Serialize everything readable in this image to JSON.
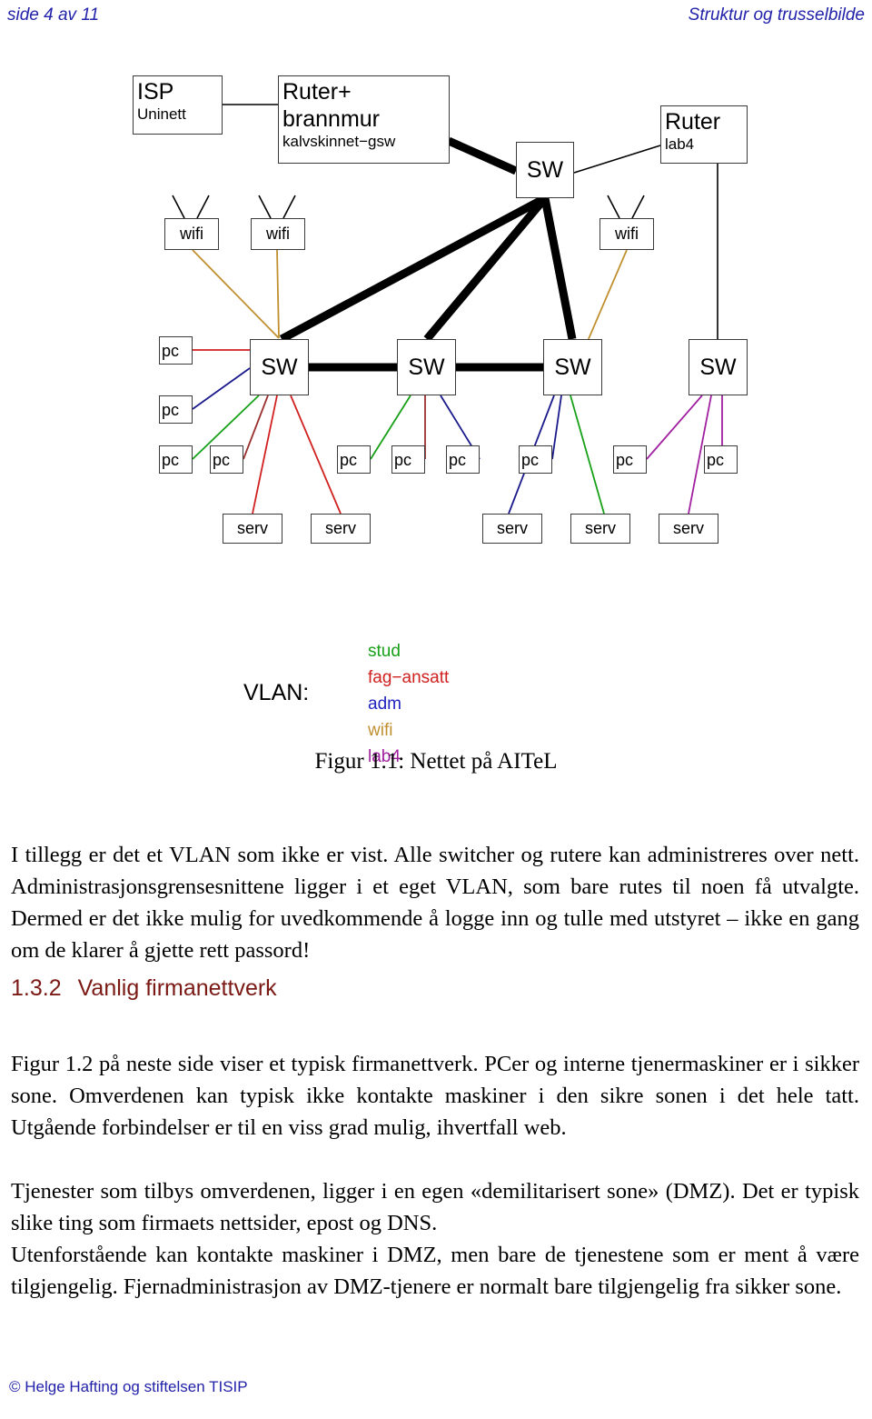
{
  "header": {
    "left": "side 4 av 11",
    "right": "Struktur og trusselbilde"
  },
  "figure": {
    "caption": "Figur 1.1: Nettet på AITeL",
    "nodes": {
      "isp": {
        "title": "ISP",
        "sub": "Uninett"
      },
      "firewall": {
        "title": "Ruter+",
        "title2": "brannmur",
        "sub": "kalvskinnet−gsw"
      },
      "core_sw": {
        "label": "SW"
      },
      "router_lab4": {
        "title": "Ruter",
        "sub": "lab4"
      },
      "wifi": [
        {
          "label": "wifi"
        },
        {
          "label": "wifi"
        },
        {
          "label": "wifi"
        }
      ],
      "switches": [
        {
          "label": "SW"
        },
        {
          "label": "SW"
        },
        {
          "label": "SW"
        },
        {
          "label": "SW"
        }
      ],
      "pcs_left_stack": [
        {
          "label": "pc"
        },
        {
          "label": "pc"
        }
      ],
      "pcs_row": [
        {
          "label": "pc"
        },
        {
          "label": "pc"
        },
        {
          "label": "pc"
        },
        {
          "label": "pc"
        },
        {
          "label": "pc"
        },
        {
          "label": "pc"
        },
        {
          "label": "pc"
        },
        {
          "label": "pc"
        }
      ],
      "servers": [
        {
          "label": "serv"
        },
        {
          "label": "serv"
        },
        {
          "label": "serv"
        },
        {
          "label": "serv"
        },
        {
          "label": "serv"
        }
      ]
    }
  },
  "vlan": {
    "label": "VLAN:",
    "items": [
      {
        "name": "stud",
        "color": "#18a018"
      },
      {
        "name": "fag−ansatt",
        "color": "#d02020"
      },
      {
        "name": "adm",
        "color": "#2222c0"
      },
      {
        "name": "wifi",
        "color": "#c09030"
      },
      {
        "name": "lab4",
        "color": "#a020a0"
      }
    ]
  },
  "colors": {
    "stud": "#18a018",
    "fag_ansatt": "#d02020",
    "fag_ansatt_dark": "#9a3030",
    "adm": "#2222c0",
    "adm_dark": "#1a1a8c",
    "wifi": "#c09030",
    "lab4": "#a020a0",
    "trunk": "#000000",
    "heading": "#7b1a15",
    "header_blue": "#2222aa"
  },
  "body": {
    "para_1": "I tillegg er det et VLAN som ikke er vist. Alle switcher og rutere kan administreres over nett. Administrasjonsgrensesnittene ligger i et eget VLAN, som bare rutes til noen få utvalgte. Dermed er det ikke mulig for uvedkommende å logge inn og tulle med utstyret – ikke en gang om de klarer å gjette rett passord!",
    "heading_number": "1.3.2",
    "heading_title": "Vanlig firmanettverk",
    "para_2": "Figur 1.2 på neste side viser et typisk firmanettverk. PCer og interne tjenermaskiner er i sikker sone. Omverdenen kan typisk ikke kontakte maskiner i den sikre sonen i det hele tatt. Utgående forbindelser er til en viss grad mulig, ihvertfall web.",
    "para_3": "Tjenester som tilbys omverdenen, ligger i en egen «demilitarisert sone» (DMZ). Det er typisk slike ting som firmaets nettsider, epost og DNS.",
    "para_4": "Utenforstående kan kontakte maskiner i DMZ, men bare de tjenestene som er ment å være tilgjengelig. Fjernadministrasjon av DMZ-tjenere er normalt bare tilgjengelig fra sikker sone."
  },
  "footer": {
    "text": "© Helge Hafting og stiftelsen TISIP"
  }
}
